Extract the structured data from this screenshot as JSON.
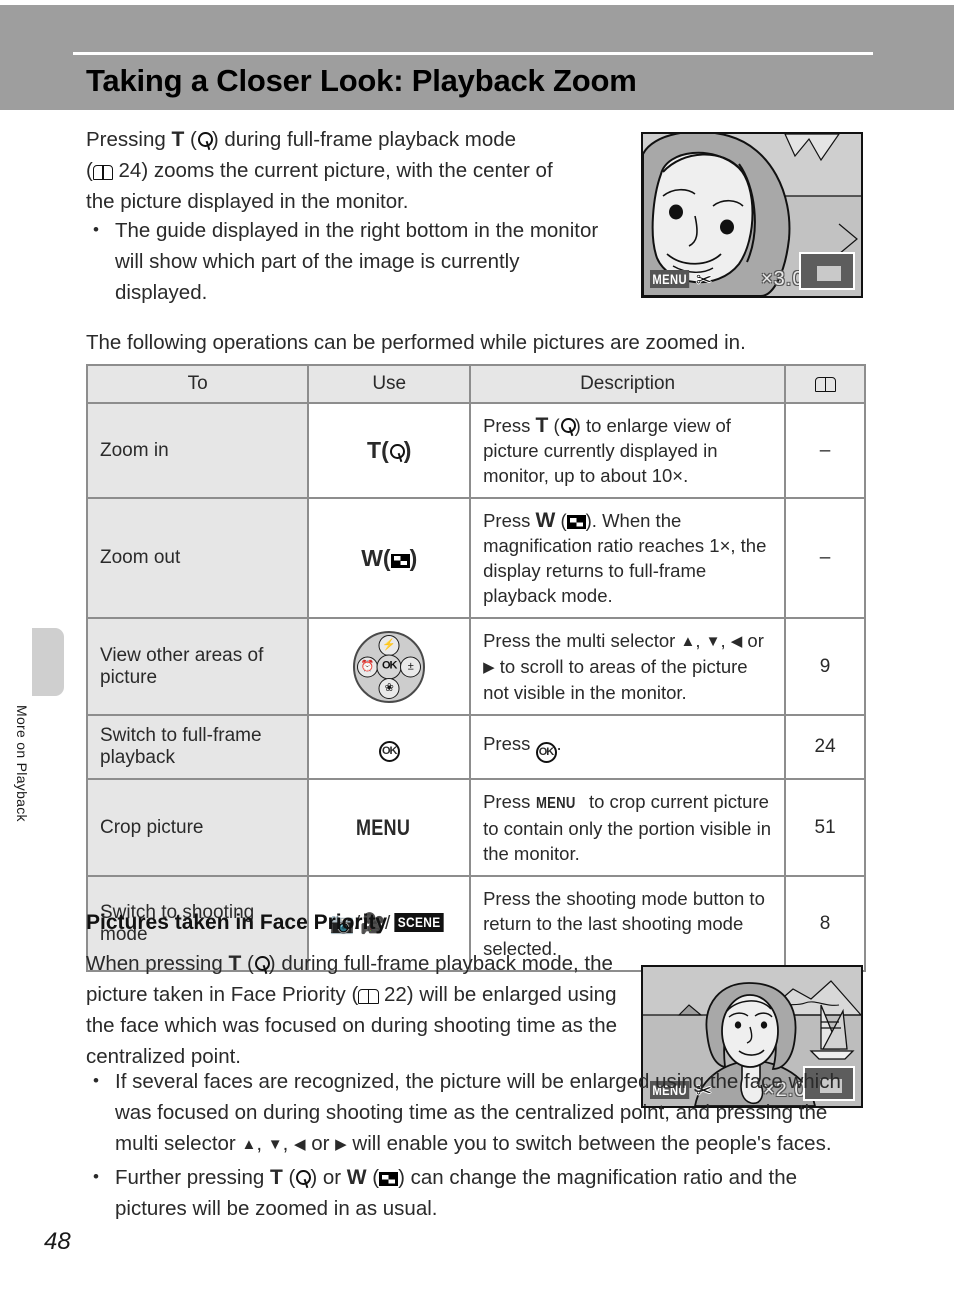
{
  "header": {
    "title": "Taking a Closer Look: Playback Zoom"
  },
  "side_tab": {
    "label": "More on Playback"
  },
  "page_number": "48",
  "intro": {
    "line1_a": "Pressing ",
    "line1_T": "T",
    "line1_b": ") during full-frame playback mode",
    "line2_a": "(",
    "line2_ref": " 24) zooms the current picture, with the center of",
    "line3": "the picture displayed in the monitor.",
    "bullet1": "The guide displayed in the right bottom in the monitor will show which part of the image is currently displayed."
  },
  "lead_in": "The following operations can be performed while pictures are zoomed in.",
  "table": {
    "headers": {
      "to": "To",
      "use": "Use",
      "description": "Description",
      "ref": "book-icon"
    },
    "rows": [
      {
        "to": "Zoom in",
        "use_label": "T",
        "use_icon": "zoom-in-magnifier-icon",
        "desc_pre": "Press ",
        "desc_T": "T",
        "desc_post": ") to enlarge view of picture currently displayed in monitor, up to about 10×.",
        "ref": "–"
      },
      {
        "to": "Zoom out",
        "use_label": "W",
        "use_icon": "thumbnail-wide-icon",
        "desc_pre": "Press ",
        "desc_W": "W",
        "desc_post": "). When the magnification ratio reaches 1×, the display returns to full-frame playback mode.",
        "ref": "–"
      },
      {
        "to": "View other areas of picture",
        "use_icon": "multi-selector-dial-icon",
        "desc_pre": "Press the multi selector ",
        "desc_post": " to scroll to areas of the picture not visible in the monitor.",
        "ref": "9"
      },
      {
        "to": "Switch to full-frame playback",
        "use_icon": "ok-button-icon",
        "desc_pre": "Press ",
        "desc_post": ".",
        "ref": "24"
      },
      {
        "to": "Crop picture",
        "use_label": "MENU",
        "desc_pre": "Press ",
        "desc_menu": "MENU",
        "desc_post": " to crop current picture to contain only the portion visible in the monitor.",
        "ref": "51"
      },
      {
        "to": "Switch to shooting mode",
        "use_icons": "camera-icon / movie-icon / SCENE",
        "scene_label": "SCENE",
        "desc": "Press the shooting mode button to return to the last shooting mode selected.",
        "ref": "8"
      }
    ]
  },
  "face_priority": {
    "heading": "Pictures taken in Face Priority",
    "para_a": "When pressing ",
    "para_T": "T",
    "para_b": ") during full-frame playback mode, the picture taken in Face Priority (",
    "para_ref": " 22) will be enlarged using the face which was focused on during shooting time as the centralized point.",
    "bullet1_a": "If several faces are recognized, the picture will be enlarged using the face which was focused on during shooting time as the centralized point, and pressing the multi selector ",
    "bullet1_b": " will enable you to switch between the people's faces.",
    "bullet2_a": "Further pressing ",
    "bullet2_T": "T",
    "bullet2_mid": ") or ",
    "bullet2_W": "W",
    "bullet2_b": ") can change the magnification ratio and the pictures will be zoomed in as usual."
  },
  "monitor_top": {
    "menu_label": "MENU",
    "scissors_icon": "scissors-icon",
    "zoom_ratio": "×3.0",
    "guide_icon": "zoom-guide-box"
  },
  "monitor_bottom": {
    "menu_label": "MENU",
    "scissors_icon": "scissors-icon",
    "zoom_ratio": "×2.0",
    "guide_icon": "zoom-guide-box"
  },
  "colors": {
    "banner": "#9e9e9e",
    "table_header": "#e6e6e6",
    "table_border": "#8d8d8d",
    "side_tab": "#cfcfcf"
  }
}
